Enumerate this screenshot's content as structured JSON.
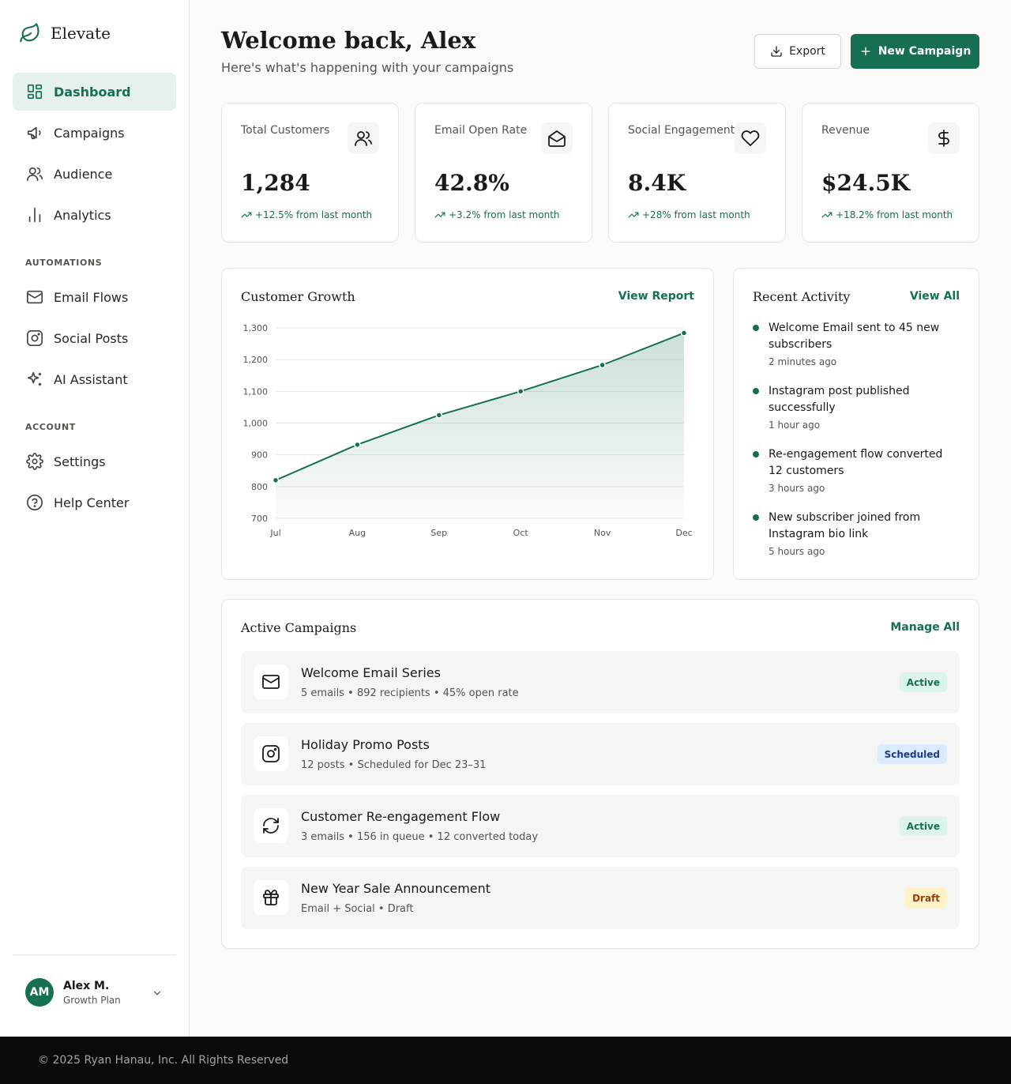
{
  "app": {
    "name": "Elevate"
  },
  "sidebar": {
    "nav": [
      {
        "label": "Dashboard",
        "icon": "dashboard-icon",
        "active": true
      },
      {
        "label": "Campaigns",
        "icon": "megaphone-icon"
      },
      {
        "label": "Audience",
        "icon": "users-icon"
      },
      {
        "label": "Analytics",
        "icon": "bar-chart-icon"
      }
    ],
    "automations_label": "AUTOMATIONS",
    "automations": [
      {
        "label": "Email Flows",
        "icon": "mail-icon"
      },
      {
        "label": "Social Posts",
        "icon": "instagram-icon"
      },
      {
        "label": "AI Assistant",
        "icon": "sparkles-icon"
      }
    ],
    "account_label": "ACCOUNT",
    "account": [
      {
        "label": "Settings",
        "icon": "gear-icon"
      },
      {
        "label": "Help Center",
        "icon": "help-circle-icon"
      }
    ],
    "user": {
      "initials": "AM",
      "name": "Alex M.",
      "plan": "Growth Plan"
    }
  },
  "header": {
    "title": "Welcome back, Alex",
    "subtitle": "Here's what's happening with your campaigns",
    "export_label": "Export",
    "new_campaign_label": "New Campaign"
  },
  "stats": [
    {
      "label": "Total Customers",
      "value": "1,284",
      "change": "+12.5% from last month",
      "icon": "users-icon"
    },
    {
      "label": "Email Open Rate",
      "value": "42.8%",
      "change": "+3.2% from last month",
      "icon": "mail-open-icon"
    },
    {
      "label": "Social Engagement",
      "value": "8.4K",
      "change": "+28% from last month",
      "icon": "heart-icon"
    },
    {
      "label": "Revenue",
      "value": "$24.5K",
      "change": "+18.2% from last month",
      "icon": "dollar-icon"
    }
  ],
  "growth": {
    "title": "Customer Growth",
    "link": "View Report"
  },
  "chart_data": {
    "type": "area",
    "title": "Customer Growth",
    "categories": [
      "Jul",
      "Aug",
      "Sep",
      "Oct",
      "Nov",
      "Dec"
    ],
    "series": [
      {
        "values": [
          820,
          932,
          1025,
          1100,
          1183,
          1284
        ]
      }
    ],
    "ylim": [
      700,
      1300
    ],
    "yticks": [
      700,
      800,
      900,
      1000,
      1100,
      1200,
      1300
    ],
    "ytick_labels": [
      "700",
      "800",
      "900",
      "1,000",
      "1,100",
      "1,200",
      "1,300"
    ],
    "grid": true,
    "color": "#166f52"
  },
  "activity": {
    "title": "Recent Activity",
    "link": "View All",
    "items": [
      {
        "text": "Welcome Email sent to 45 new subscribers",
        "time": "2 minutes ago"
      },
      {
        "text": "Instagram post published successfully",
        "time": "1 hour ago"
      },
      {
        "text": "Re-engagement flow converted 12 customers",
        "time": "3 hours ago"
      },
      {
        "text": "New subscriber joined from Instagram bio link",
        "time": "5 hours ago"
      }
    ]
  },
  "campaigns": {
    "title": "Active Campaigns",
    "link": "Manage All",
    "items": [
      {
        "name": "Welcome Email Series",
        "meta": "5 emails • 892 recipients • 45% open rate",
        "status": "Active",
        "icon": "mail-icon"
      },
      {
        "name": "Holiday Promo Posts",
        "meta": "12 posts • Scheduled for Dec 23–31",
        "status": "Scheduled",
        "icon": "instagram-icon"
      },
      {
        "name": "Customer Re-engagement Flow",
        "meta": "3 emails • 156 in queue • 12 converted today",
        "status": "Active",
        "icon": "refresh-icon"
      },
      {
        "name": "New Year Sale Announcement",
        "meta": "Email + Social • Draft",
        "status": "Draft",
        "icon": "gift-icon"
      }
    ]
  },
  "badge_colors": {
    "Active": {
      "bg": "#dcf5ea",
      "fg": "#166f52"
    },
    "Scheduled": {
      "bg": "#dbeafe",
      "fg": "#1e3a8a"
    },
    "Draft": {
      "bg": "#fef3c7",
      "fg": "#92400e"
    }
  },
  "footer": {
    "text": "© 2025 Ryan Hanau, Inc. All Rights Reserved"
  }
}
